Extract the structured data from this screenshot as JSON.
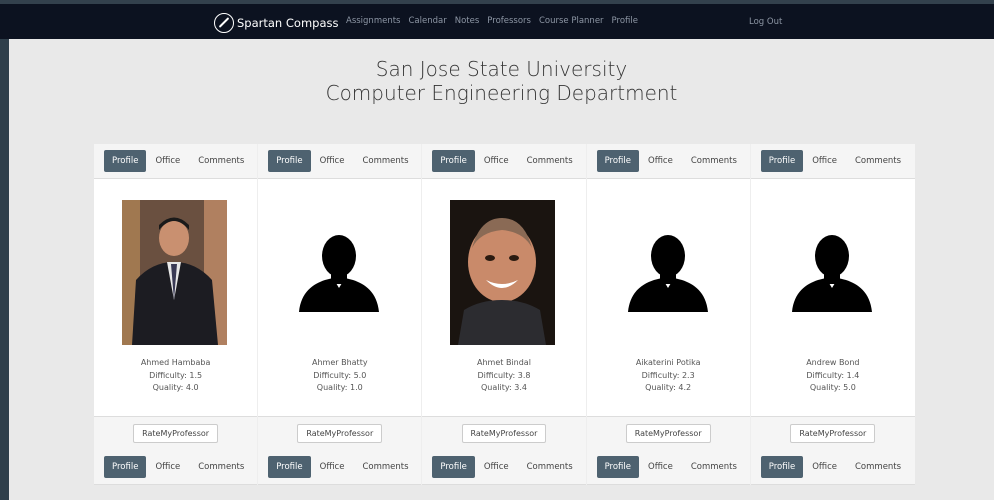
{
  "navbar": {
    "brand": "Spartan Compass",
    "links": [
      "Assignments",
      "Calendar",
      "Notes",
      "Professors",
      "Course Planner",
      "Profile"
    ],
    "logout": "Log Out"
  },
  "header": {
    "line1": "San Jose State University",
    "line2": "Computer Engineering Department"
  },
  "tabs": [
    "Profile",
    "Office",
    "Comments"
  ],
  "rmp_label": "RateMyProfessor",
  "professors": [
    {
      "name": "Ahmed Hambaba",
      "difficulty": "Difficulty: 1.5",
      "quality": "Quality: 4.0",
      "photo": "photo-man-suit"
    },
    {
      "name": "Ahmer Bhatty",
      "difficulty": "Difficulty: 5.0",
      "quality": "Quality: 1.0",
      "photo": "silhouette-icon"
    },
    {
      "name": "Ahmet Bindal",
      "difficulty": "Difficulty: 3.8",
      "quality": "Quality: 3.4",
      "photo": "photo-man-smiling"
    },
    {
      "name": "Aikaterini Potika",
      "difficulty": "Difficulty: 2.3",
      "quality": "Quality: 4.2",
      "photo": "silhouette-icon"
    },
    {
      "name": "Andrew Bond",
      "difficulty": "Difficulty: 1.4",
      "quality": "Quality: 5.0",
      "photo": "silhouette-icon"
    }
  ]
}
